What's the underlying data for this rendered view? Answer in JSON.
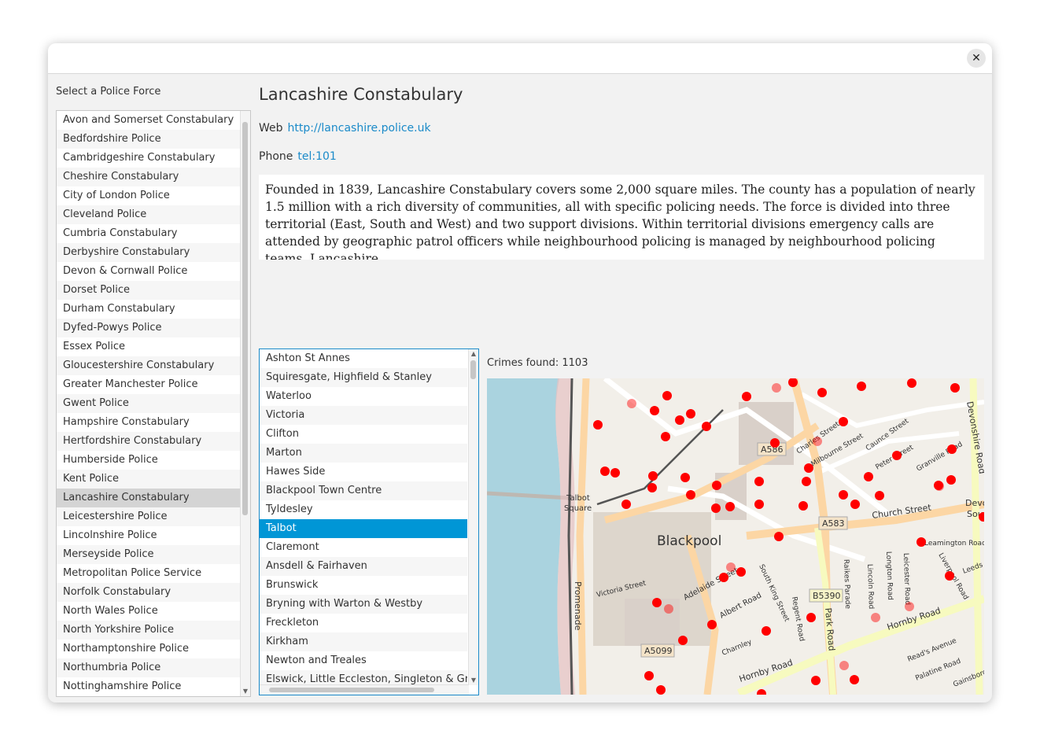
{
  "window": {
    "close_label": "✕"
  },
  "forces": {
    "label": "Select a Police Force",
    "items": [
      "Avon and Somerset Constabulary",
      "Bedfordshire Police",
      "Cambridgeshire Constabulary",
      "Cheshire Constabulary",
      "City of London Police",
      "Cleveland Police",
      "Cumbria Constabulary",
      "Derbyshire Constabulary",
      "Devon & Cornwall Police",
      "Dorset Police",
      "Durham Constabulary",
      "Dyfed-Powys Police",
      "Essex Police",
      "Gloucestershire Constabulary",
      "Greater Manchester Police",
      "Gwent Police",
      "Hampshire Constabulary",
      "Hertfordshire Constabulary",
      "Humberside Police",
      "Kent Police",
      "Lancashire Constabulary",
      "Leicestershire Police",
      "Lincolnshire Police",
      "Merseyside Police",
      "Metropolitan Police Service",
      "Norfolk Constabulary",
      "North Wales Police",
      "North Yorkshire Police",
      "Northamptonshire Police",
      "Northumbria Police",
      "Nottinghamshire Police"
    ],
    "selected_index": 20
  },
  "detail": {
    "title": "Lancashire Constabulary",
    "web_label": "Web",
    "web_url": "http://lancashire.police.uk",
    "phone_label": "Phone",
    "phone_value": "tel:101",
    "description": "Founded in 1839, Lancashire Constabulary covers some 2,000 square miles. The county has a population of nearly 1.5 million with a rich diversity of communities, all with specific policing needs. The force is divided into three territorial (East, South and West) and two support divisions. Within territorial divisions emergency calls are attended by geographic patrol officers while neighbourhood policing is managed by neighbourhood policing teams. Lancashire"
  },
  "neighbourhoods": {
    "items": [
      "Ashton St Annes",
      "Squiresgate, Highfield & Stanley",
      "Waterloo",
      "Victoria",
      "Clifton",
      "Marton",
      "Hawes Side",
      "Blackpool Town Centre",
      "Tyldesley",
      "Talbot",
      "Claremont",
      "Ansdell & Fairhaven",
      "Brunswick",
      "Bryning with Warton & Westby",
      "Freckleton",
      "Kirkham",
      "Newton and Treales",
      "Elswick, Little Eccleston, Singleton & Greenhalgh"
    ],
    "selected_index": 9
  },
  "crimes": {
    "label": "Crimes found:",
    "count": "1103"
  },
  "map": {
    "colors": {
      "sea": "#aad3df",
      "land": "#f2efe9",
      "road": "#ffffff",
      "primary": "#fcd6a4",
      "secondary": "#f7fabf",
      "building": "#d9d0c9",
      "rail": "#555555",
      "marker": "#ff0000"
    },
    "labels": {
      "town": "Blackpool",
      "talbot1": "Talbot",
      "talbot2": "Square",
      "a586": "A586",
      "a583": "A583",
      "a5099": "A5099",
      "b5390": "B5390",
      "church": "Church Street",
      "hornby1": "Hornby Road",
      "hornby2": "Hornby Road",
      "promenade": "Promenade",
      "devonshire": "Devonshire Road",
      "park": "Park Road",
      "adelaide": "Adelaide Street",
      "albert": "Albert Road",
      "victoria": "Victoria Street",
      "charnley": "Charnley",
      "charles": "Charles Street",
      "milbourne": "Milbourne Street",
      "caunce": "Caunce Street",
      "peter": "Peter Street",
      "granville": "Granville Road",
      "leamington": "Leamington Road",
      "leeds": "Leeds Road",
      "liverpool": "Liverpool Road",
      "lincoln": "Lincoln Road",
      "longton": "Longton Road",
      "leicester": "Leicester Road",
      "raikes": "Raikes Parade",
      "regent": "Regent Road",
      "southking": "South King Street",
      "reads": "Read's Avenue",
      "palatine": "Palatine Road",
      "gainsborough": "Gainsborough",
      "devon2": "Devon",
      "sou": "Sou"
    }
  }
}
